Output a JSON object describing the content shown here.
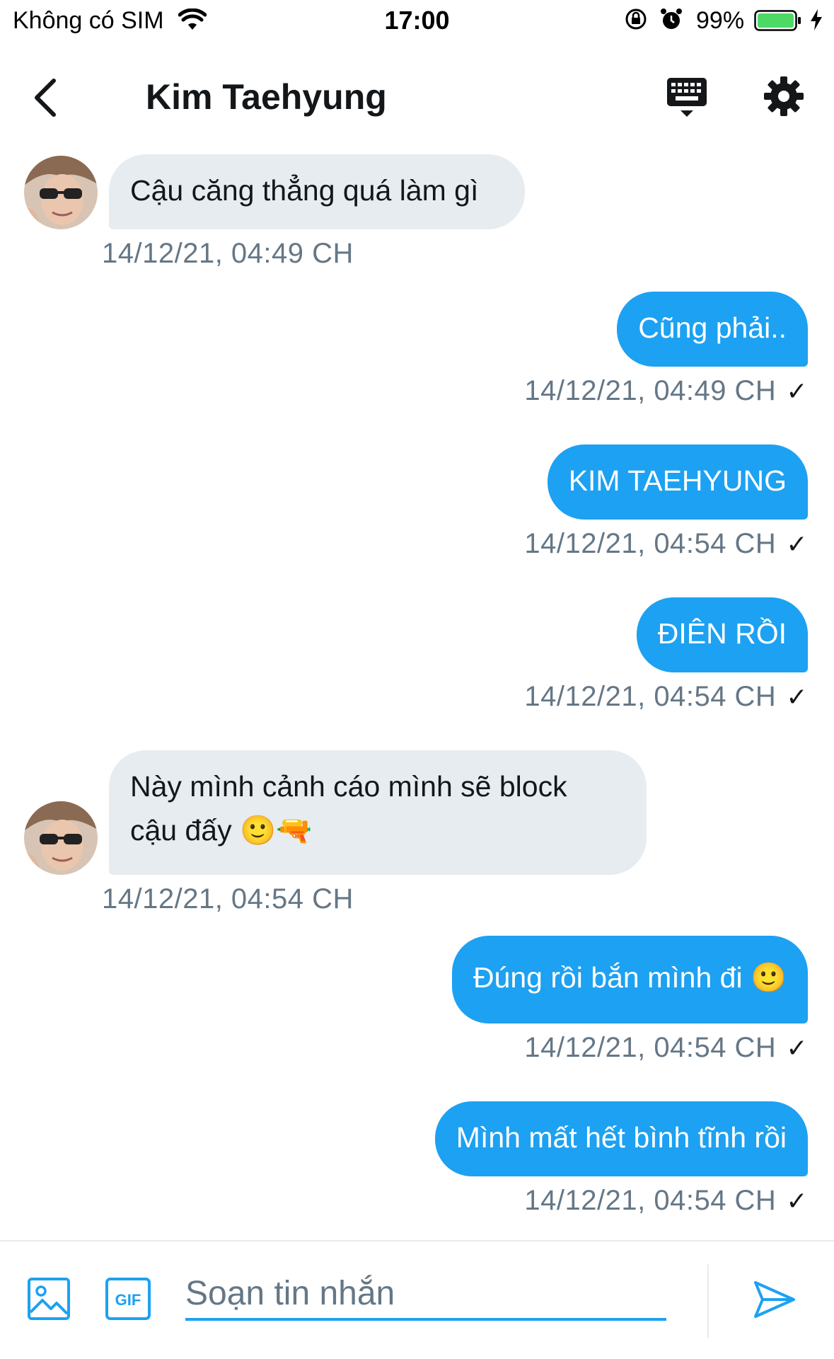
{
  "status_bar": {
    "carrier": "Không có SIM",
    "time": "17:00",
    "battery": "99%"
  },
  "header": {
    "title": "Kim Taehyung"
  },
  "messages": [
    {
      "direction": "in",
      "text": "Cậu căng thẳng quá làm gì",
      "time": "14/12/21, 04:49 CH"
    },
    {
      "direction": "out",
      "text": "Cũng phải..",
      "time": "14/12/21, 04:49 CH"
    },
    {
      "direction": "out",
      "text": "KIM TAEHYUNG",
      "time": "14/12/21, 04:54 CH"
    },
    {
      "direction": "out",
      "text": "ĐIÊN RỒI",
      "time": "14/12/21, 04:54 CH"
    },
    {
      "direction": "in",
      "text_line1": "Này mình cảnh cáo mình sẽ block",
      "text_line2": "cậu đấy 🙂🔫",
      "time": "14/12/21, 04:54 CH"
    },
    {
      "direction": "out",
      "text": "Đúng rồi bắn mình đi 🙂",
      "time": "14/12/21, 04:54 CH"
    },
    {
      "direction": "out",
      "text": "Mình mất hết bình tĩnh rồi",
      "time": "14/12/21, 04:54 CH"
    }
  ],
  "check_mark": "✓",
  "composer": {
    "placeholder": "Soạn tin nhắn",
    "gif_label": "GIF"
  },
  "colors": {
    "accent": "#1da1f2",
    "incoming_bubble": "#e6ecf0",
    "timestamp": "#657786"
  },
  "icons": [
    "wifi-icon",
    "orientation-lock-icon",
    "alarm-icon",
    "battery-icon",
    "charging-bolt-icon",
    "back-arrow-icon",
    "keyboard-icon",
    "gear-icon",
    "image-icon",
    "gif-icon",
    "send-icon"
  ]
}
